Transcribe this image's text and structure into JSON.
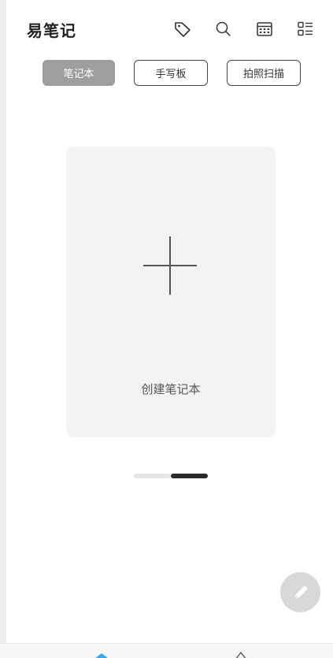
{
  "header": {
    "title": "易笔记"
  },
  "toolbar": {
    "icons": [
      "tag-icon",
      "search-icon",
      "calendar-icon",
      "list-view-icon"
    ]
  },
  "tabs": [
    {
      "label": "笔记本",
      "active": true
    },
    {
      "label": "手写板",
      "active": false
    },
    {
      "label": "拍照扫描",
      "active": false
    }
  ],
  "card": {
    "label": "创建笔记本"
  },
  "pager": {
    "count": 2,
    "active_index": 1
  },
  "colors": {
    "active_tab": "#9e9e9e",
    "card_bg": "#f3f3f3",
    "fab_bg": "#d8d8d8",
    "nav_accent": "#3ea6e8"
  }
}
